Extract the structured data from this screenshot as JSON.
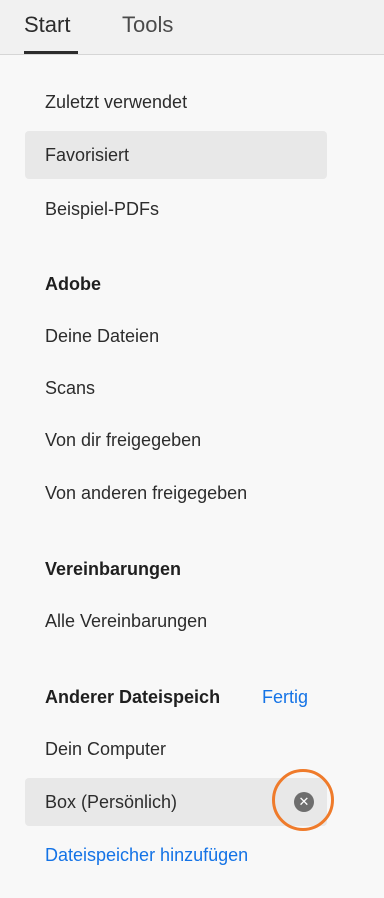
{
  "tabs": {
    "start_label": "Start",
    "tools_label": "Tools"
  },
  "recent": {
    "recent_label": "Zuletzt verwendet",
    "starred_label": "Favorisiert",
    "samples_label": "Beispiel-PDFs"
  },
  "adobe": {
    "heading": "Adobe",
    "items": [
      "Deine Dateien",
      "Scans",
      "Von dir freigegeben",
      "Von anderen freigegeben"
    ]
  },
  "agreements": {
    "heading": "Vereinbarungen",
    "all_label": "Alle Vereinbarungen"
  },
  "other_storage": {
    "heading": "Anderer Dateispeich",
    "done_label": "Fertig",
    "computer_label": "Dein Computer",
    "box_label": "Box (Persönlich)",
    "remove_icon": "close-circle-icon",
    "add_label": "Dateispeicher hinzufügen"
  },
  "colors": {
    "link": "#1473e6",
    "annotation_ring": "#ef7b2b",
    "selected_bg": "#e8e8e8"
  }
}
